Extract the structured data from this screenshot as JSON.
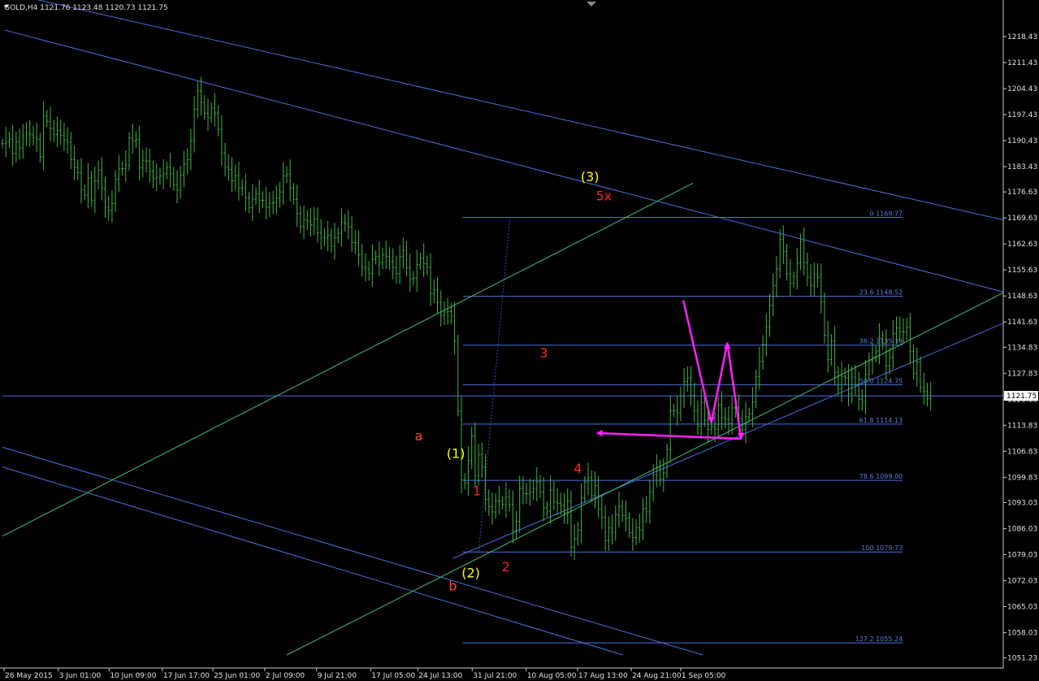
{
  "header": {
    "symbol_info": "GOLD,H4  1121.76 1123.48 1120.73 1121.75"
  },
  "colors": {
    "background": "#000000",
    "candle": "#3fb53f",
    "channel": "#4a6ee0",
    "trend": "#40c070",
    "fib": "#4a6ee0",
    "arrow": "#ff20ff",
    "axis_text": "#e0e0e0"
  },
  "chart_data": {
    "type": "candlestick",
    "symbol": "GOLD",
    "timeframe": "H4",
    "ylim": [
      1048.5,
      1225.0
    ],
    "y_ticks": [
      "1218.43",
      "1211.43",
      "1204.43",
      "1197.43",
      "1190.43",
      "1183.43",
      "1176.63",
      "1169.63",
      "1162.63",
      "1155.63",
      "1148.63",
      "1141.63",
      "1134.83",
      "1127.83",
      "1120.83",
      "1113.83",
      "1106.83",
      "1099.83",
      "1093.03",
      "1086.03",
      "1079.03",
      "1072.03",
      "1065.03",
      "1058.03",
      "1051.23"
    ],
    "x_labels": [
      "26 May 2015",
      "3 Jun 01:00",
      "10 Jun 09:00",
      "17 Jun 17:00",
      "25 Jun 01:00",
      "2 Jul 09:00",
      "9 Jul 21:00",
      "17 Jul 05:00",
      "24 Jul 13:00",
      "31 Jul 21:00",
      "10 Aug 05:00",
      "17 Aug 13:00",
      "24 Aug 21:00",
      "1 Sep 05:00"
    ],
    "current_price": "1121.75",
    "closes": [
      1189.6,
      1190.2,
      1190.8,
      1187.0,
      1190.2,
      1188.5,
      1191.7,
      1192.4,
      1192.0,
      1191.3,
      1190.8,
      1186.1,
      1197.0,
      1195.6,
      1193.7,
      1192.1,
      1193.2,
      1191.9,
      1190.6,
      1190.0,
      1185.3,
      1183.2,
      1181.8,
      1177.1,
      1175.8,
      1180.4,
      1174.4,
      1179.6,
      1182.5,
      1177.5,
      1172.5,
      1171.6,
      1173.5,
      1180.0,
      1182.8,
      1182.9,
      1183.8,
      1191.1,
      1190.4,
      1190.7,
      1183.1,
      1185.2,
      1184.9,
      1182.2,
      1180.2,
      1180.6,
      1180.9,
      1181.5,
      1183.2,
      1181.5,
      1178.6,
      1177.1,
      1181.1,
      1184.1,
      1185.3,
      1190.4,
      1198.9,
      1203.8,
      1200.7,
      1197.8,
      1196.6,
      1199.2,
      1197.8,
      1193.5,
      1187.1,
      1183.3,
      1182.7,
      1179.6,
      1181.0,
      1177.6,
      1177.7,
      1175.0,
      1172.4,
      1174.7,
      1176.1,
      1174.4,
      1174.4,
      1172.5,
      1173.6,
      1173.7,
      1174.9,
      1176.6,
      1180.9,
      1181.4,
      1177.6,
      1174.6,
      1170.8,
      1167.3,
      1169.1,
      1168.8,
      1167.8,
      1169.4,
      1165.7,
      1164.4,
      1164.2,
      1164.9,
      1162.0,
      1164.3,
      1165.5,
      1168.4,
      1168.0,
      1167.2,
      1163.0,
      1162.9,
      1159.8,
      1156.4,
      1155.9,
      1154.7,
      1158.5,
      1159.3,
      1157.6,
      1159.7,
      1159.3,
      1157.9,
      1156.3,
      1154.6,
      1159.2,
      1160.9,
      1156.2,
      1153.2,
      1153.4,
      1157.1,
      1158.8,
      1157.3,
      1156.3,
      1149.3,
      1150.3,
      1146.8,
      1143.4,
      1144.3,
      1144.4,
      1143.2,
      1136.5,
      1117.7,
      1099.1,
      1098.3,
      1104.3,
      1110.9,
      1100.3,
      1105.9,
      1102.5,
      1093.9,
      1091.9,
      1090.5,
      1093.5,
      1093.4,
      1092.5,
      1094.5,
      1092.5,
      1085.5,
      1088.0,
      1096.8,
      1095.4,
      1095.4,
      1095.8,
      1096.8,
      1098.6,
      1095.9,
      1091.6,
      1090.7,
      1096.4,
      1093.2,
      1092.8,
      1092.3,
      1090.3,
      1093.5,
      1081.0,
      1083.3,
      1085.6,
      1094.2,
      1098.6,
      1099.7,
      1094.9,
      1097.6,
      1091.3,
      1089.0,
      1082.8,
      1086.2,
      1085.0,
      1089.7,
      1092.0,
      1089.5,
      1088.8,
      1084.9,
      1083.6,
      1086.3,
      1085.6,
      1091.4,
      1090.5,
      1095.8,
      1100.5,
      1102.3,
      1099.4,
      1101.0,
      1107.3,
      1117.7,
      1117.8,
      1117.2,
      1121.7,
      1125.6,
      1126.6,
      1121.8,
      1117.8,
      1113.6,
      1119.9,
      1115.2,
      1112.6,
      1113.4,
      1112.8,
      1119.3,
      1115.9,
      1115.5,
      1114.3,
      1118.5,
      1118.5,
      1115.6,
      1112.6,
      1116.2,
      1116.9,
      1120.1,
      1126.9,
      1131.0,
      1135.6,
      1140.3,
      1146.1,
      1151.4,
      1155.9,
      1163.8,
      1160.6,
      1154.6,
      1152.1,
      1153.9,
      1157.5,
      1163.3,
      1157.6,
      1153.7,
      1151.5,
      1154.4,
      1153.7,
      1147.1,
      1138.0,
      1131.5,
      1136.6,
      1128.1,
      1123.6,
      1127.0,
      1126.6,
      1122.3,
      1126.8,
      1124.8,
      1120.8,
      1120.2,
      1127.6,
      1131.2,
      1132.1,
      1133.8,
      1137.3,
      1135.8,
      1129.8,
      1132.1,
      1138.5,
      1140.0,
      1139.0,
      1139.0,
      1140.2,
      1133.7,
      1127.8,
      1130.8,
      1124.0,
      1123.0,
      1121.0,
      1121.75
    ],
    "fib_levels": [
      {
        "pct": "0",
        "price": 1169.77,
        "label": "0 1169.77"
      },
      {
        "pct": "23.6",
        "price": 1148.52,
        "label": "23.6 1148.52"
      },
      {
        "pct": "38.2",
        "price": 1135.39,
        "label": "38.2 1135.39"
      },
      {
        "pct": "50.0",
        "price": 1124.75,
        "label": "50.0 1124.75"
      },
      {
        "pct": "61.8",
        "price": 1114.13,
        "label": "61.8 1114.13"
      },
      {
        "pct": "78.6",
        "price": 1099.0,
        "label": "78.6 1099.00"
      },
      {
        "pct": "100",
        "price": 1079.73,
        "label": "100 1079.73"
      },
      {
        "pct": "127.2",
        "price": 1055.24,
        "label": "127.2 1055.24"
      }
    ],
    "wave_labels": [
      {
        "text": "(3)",
        "color": "#ffff00",
        "x": 0.587,
        "y": 1179.5
      },
      {
        "text": "5x",
        "color": "#ff2020",
        "x": 0.601,
        "y": 1174.4
      },
      {
        "text": "3",
        "color": "#ff2020",
        "x": 0.541,
        "y": 1132.0
      },
      {
        "text": "a",
        "color": "#ff5020",
        "x": 0.416,
        "y": 1109.7
      },
      {
        "text": "(1)",
        "color": "#ffff00",
        "x": 0.453,
        "y": 1105.0
      },
      {
        "text": "1",
        "color": "#ff2020",
        "x": 0.474,
        "y": 1095.0
      },
      {
        "text": "4",
        "color": "#ff2020",
        "x": 0.575,
        "y": 1101.0
      },
      {
        "text": "2",
        "color": "#ff2020",
        "x": 0.503,
        "y": 1074.5
      },
      {
        "text": "(2)",
        "color": "#ffff00",
        "x": 0.468,
        "y": 1072.9
      },
      {
        "text": "b",
        "color": "#ff5020",
        "x": 0.45,
        "y": 1069.4
      }
    ]
  }
}
